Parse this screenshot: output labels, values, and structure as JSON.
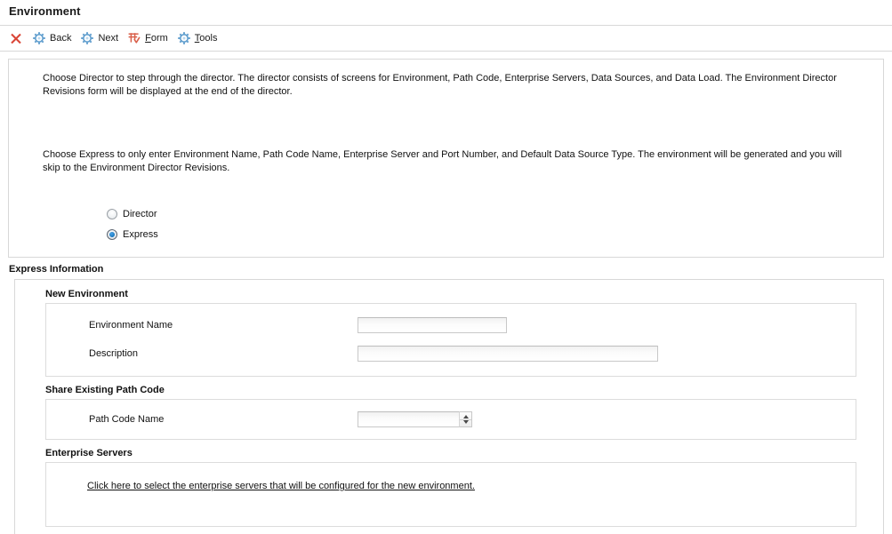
{
  "header": {
    "title": "Environment"
  },
  "toolbar": {
    "items": [
      {
        "id": "close",
        "icon": "close-x-icon",
        "label": "",
        "mnemonic": ""
      },
      {
        "id": "back",
        "icon": "gear-icon",
        "label": "Back",
        "mnemonic": ""
      },
      {
        "id": "next",
        "icon": "gear-icon",
        "label": "Next",
        "mnemonic": ""
      },
      {
        "id": "form",
        "icon": "form-grid-icon",
        "label": "Form",
        "mnemonic": "F"
      },
      {
        "id": "tools",
        "icon": "gear-icon",
        "label": "Tools",
        "mnemonic": "T"
      }
    ]
  },
  "intro": {
    "paragraph1": "Choose Director to step through the director. The director consists of screens for Environment, Path Code, Enterprise Servers, Data Sources, and Data Load. The Environment Director Revisions form will be displayed at the end of the director.",
    "paragraph2": "Choose Express to only enter Environment Name, Path Code Name, Enterprise Server and Port Number, and Default Data Source Type. The environment will be generated and you will skip to the Environment Director Revisions."
  },
  "mode_options": {
    "director": {
      "label": "Director",
      "selected": false
    },
    "express": {
      "label": "Express",
      "selected": true
    }
  },
  "express_section": {
    "title": "Express Information",
    "new_environment": {
      "group_label": "New Environment",
      "fields": {
        "environment_name": {
          "label": "Environment Name",
          "value": "",
          "placeholder": ""
        },
        "description": {
          "label": "Description",
          "value": "",
          "placeholder": ""
        }
      }
    },
    "share_path_code": {
      "group_label": "Share Existing Path Code",
      "fields": {
        "path_code_name": {
          "label": "Path Code Name",
          "value": "",
          "placeholder": ""
        }
      }
    },
    "enterprise_servers": {
      "group_label": "Enterprise Servers",
      "link_text": "Click here to select the enterprise servers that will be configured for the new environment."
    }
  },
  "colors": {
    "accent_blue": "#1f7ec4",
    "icon_blue": "#4a90c4",
    "icon_red": "#d94436",
    "border": "#d8d8d8",
    "text": "#111111"
  }
}
